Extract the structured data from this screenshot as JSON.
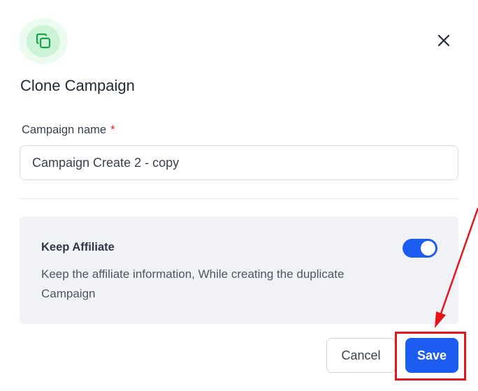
{
  "dialog": {
    "title": "Clone Campaign",
    "icon": "copy-icon",
    "close_icon": "close-icon"
  },
  "campaign_name": {
    "label": "Campaign name",
    "required_marker": "*",
    "value": "Campaign Create 2 - copy"
  },
  "keep_affiliate": {
    "title": "Keep Affiliate",
    "description": "Keep the affiliate information, While creating the duplicate Campaign",
    "enabled": true
  },
  "actions": {
    "cancel_label": "Cancel",
    "save_label": "Save"
  },
  "colors": {
    "primary": "#1d5cf0",
    "icon_green": "#16a34a",
    "annotation_red": "#e8141b",
    "required_red": "#dc2626"
  }
}
